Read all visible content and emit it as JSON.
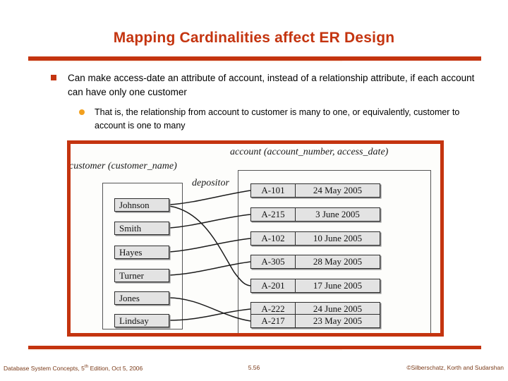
{
  "slide": {
    "title": "Mapping Cardinalities affect ER Design",
    "accent_color": "#c4340f",
    "bullet_square_color": "#c4340f",
    "bullet_dot_color": "#f2a01e"
  },
  "bullets": [
    {
      "level": 1,
      "marker": "square",
      "text": "Can make access-date an attribute of account, instead of a relationship attribute, if each account can have only one customer"
    },
    {
      "level": 2,
      "marker": "dot",
      "text": "That is, the relationship from account to customer is many to one, or equivalently, customer to account is one to many"
    }
  ],
  "figure": {
    "customer_label": "customer (customer_name)",
    "account_label": "account (account_number, access_date)",
    "relationship_label": "depositor",
    "customers": [
      {
        "name": "Johnson"
      },
      {
        "name": "Smith"
      },
      {
        "name": "Hayes"
      },
      {
        "name": "Turner"
      },
      {
        "name": "Jones"
      },
      {
        "name": "Lindsay"
      }
    ],
    "accounts": [
      {
        "number": "A-101",
        "access_date": "24 May 2005"
      },
      {
        "number": "A-215",
        "access_date": "3 June 2005"
      },
      {
        "number": "A-102",
        "access_date": "10 June 2005"
      },
      {
        "number": "A-305",
        "access_date": "28 May 2005"
      },
      {
        "number": "A-201",
        "access_date": "17 June 2005"
      },
      {
        "number": "A-222",
        "access_date": "24 June 2005"
      },
      {
        "number": "A-217",
        "access_date": "23 May 2005"
      }
    ],
    "links": [
      {
        "customer": "Johnson",
        "account": "A-101"
      },
      {
        "customer": "Johnson",
        "account": "A-201"
      },
      {
        "customer": "Smith",
        "account": "A-215"
      },
      {
        "customer": "Hayes",
        "account": "A-102"
      },
      {
        "customer": "Turner",
        "account": "A-305"
      },
      {
        "customer": "Jones",
        "account": "A-217"
      },
      {
        "customer": "Lindsay",
        "account": "A-222"
      }
    ]
  },
  "footer": {
    "left_pre": "Database System Concepts, 5",
    "left_sup": "th",
    "left_post": " Edition, Oct 5, 2006",
    "page": "5.56",
    "right": "©Silberschatz, Korth and Sudarshan"
  }
}
